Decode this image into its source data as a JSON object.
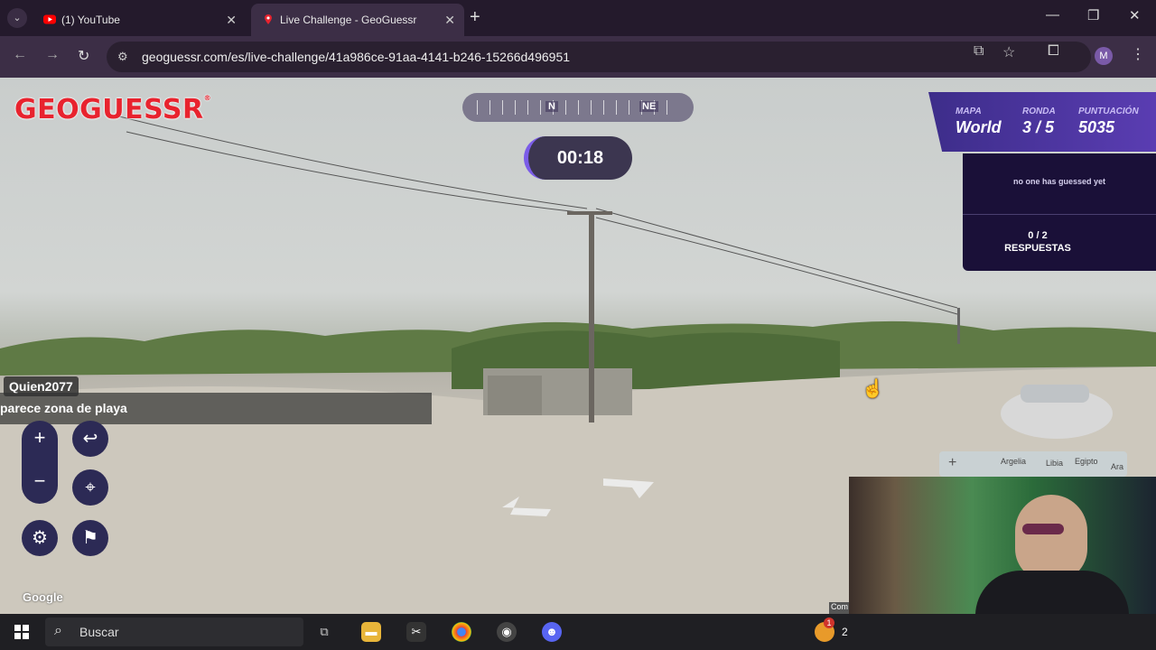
{
  "browser": {
    "tabs": [
      {
        "label": "(1) YouTube",
        "active": false
      },
      {
        "label": "Live Challenge - GeoGuessr",
        "active": true
      }
    ],
    "url": "geoguessr.com/es/live-challenge/41a986ce-91aa-4141-b246-15266d496951",
    "profile_initial": "M"
  },
  "game": {
    "logo": "GEOGUESSR",
    "compass": {
      "labels": [
        "N",
        "NE"
      ]
    },
    "timer": "00:18",
    "stats": [
      {
        "key": "MAPA",
        "value": "World"
      },
      {
        "key": "RONDA",
        "value": "3 / 5"
      },
      {
        "key": "PUNTUACIÓN",
        "value": "5035"
      }
    ],
    "guess_panel": {
      "status": "no one has guessed yet",
      "count": "0 / 2",
      "count_label": "RESPUESTAS"
    },
    "chat": {
      "user": "Quien2077",
      "message": "parece zona de playa"
    },
    "controls": {
      "zoom_in": "+",
      "zoom_out": "−",
      "undo": "↩",
      "pin": "⌖",
      "settings": "⚙",
      "flag": "⚑"
    },
    "attribution": "Google",
    "minimap": {
      "countries": [
        "Argelia",
        "Libia",
        "Egipto",
        "Ara Sau"
      ]
    },
    "overlay_tag": "Com"
  },
  "taskbar": {
    "search_placeholder": "Buscar",
    "notif_badge": "1",
    "clock_partial": "2"
  },
  "colors": {
    "accent": "#7b5ce8",
    "brand_red": "#e8232e",
    "panel_bg": "#1a1038",
    "stats_bg": "#5a3db2"
  }
}
